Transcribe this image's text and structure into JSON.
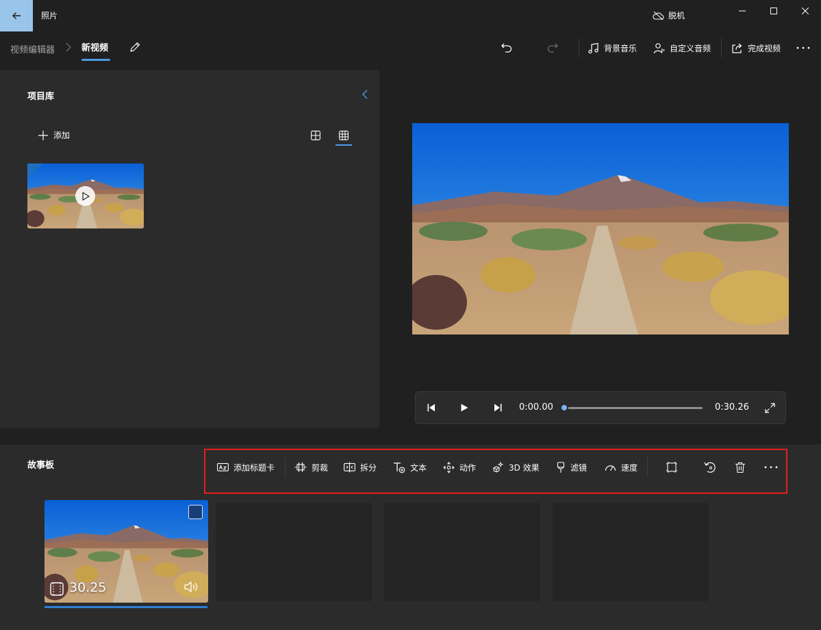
{
  "titlebar": {
    "app_title": "照片",
    "offline_label": "脱机"
  },
  "breadcrumb": {
    "root": "视频编辑器",
    "current": "新视频"
  },
  "commands": {
    "background_music": "背景音乐",
    "custom_audio": "自定义音频",
    "finish_video": "完成视频"
  },
  "library": {
    "title": "项目库",
    "add_label": "添加"
  },
  "player": {
    "current_time": "0:00.00",
    "total_time": "0:30.26",
    "progress": 0
  },
  "storyboard": {
    "title": "故事板",
    "toolbar": {
      "add_title_card": "添加标题卡",
      "trim": "剪裁",
      "split": "拆分",
      "text": "文本",
      "motion": "动作",
      "effects_3d": "3D 效果",
      "filters": "滤镜",
      "speed": "速度"
    },
    "clips": [
      {
        "duration": "30.25",
        "selected": true
      }
    ]
  },
  "colors": {
    "accent": "#4c9be8",
    "highlight_frame": "#e81c1c",
    "background": "#202020",
    "panel": "#2b2b2b"
  }
}
